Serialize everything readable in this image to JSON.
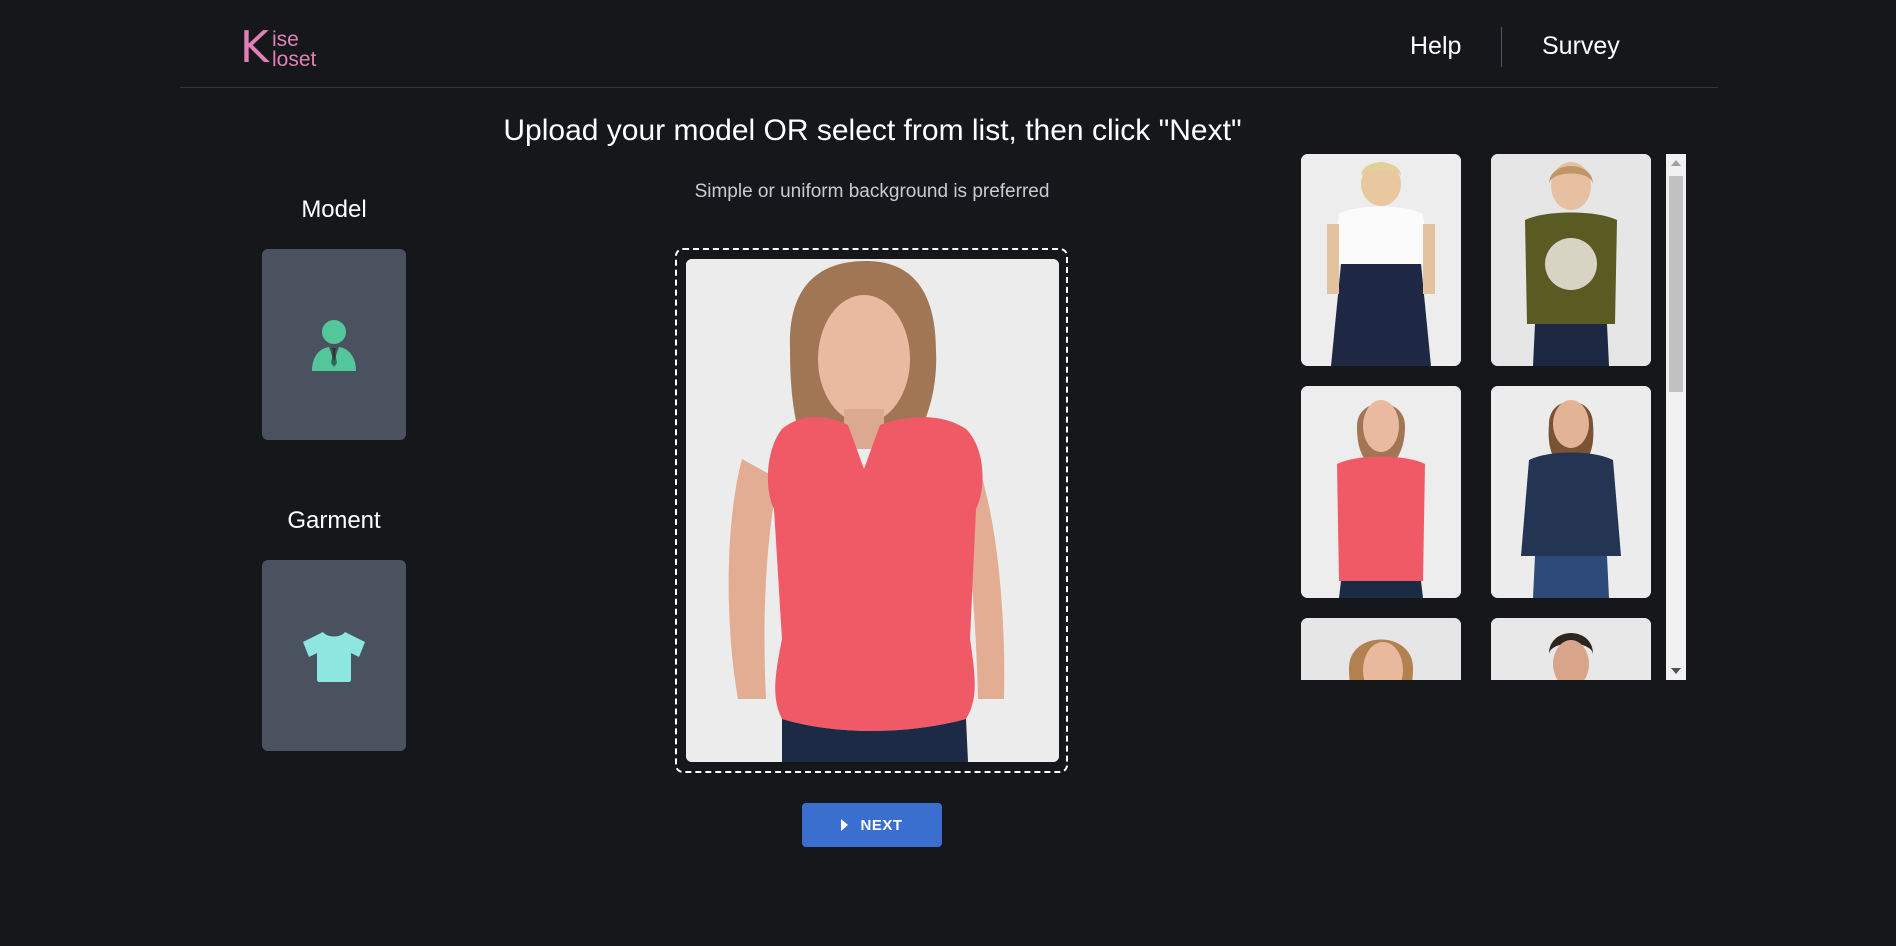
{
  "brand": {
    "logo_k": "K",
    "logo_line1": "ise",
    "logo_line2": "loset",
    "color": "#e27fb7"
  },
  "nav": {
    "help_label": "Help",
    "survey_label": "Survey"
  },
  "main": {
    "title": "Upload your model OR select from list, then click \"Next\"",
    "subtitle": "Simple or uniform background is preferred",
    "next_label": "NEXT",
    "accent_color": "#3a6fcf"
  },
  "sidebar": {
    "model_label": "Model",
    "garment_label": "Garment",
    "model_icon": "person-icon",
    "garment_icon": "tshirt-icon",
    "icon_colors": {
      "model": "#53c79b",
      "garment": "#8ee6e1"
    }
  },
  "gallery": {
    "items": [
      {
        "name": "model-white-blouse-denim-skirt"
      },
      {
        "name": "model-olive-graphic-tee"
      },
      {
        "name": "model-coral-top"
      },
      {
        "name": "model-navy-print-top"
      },
      {
        "name": "model-wavy-hair"
      },
      {
        "name": "model-dark-hair"
      }
    ]
  }
}
